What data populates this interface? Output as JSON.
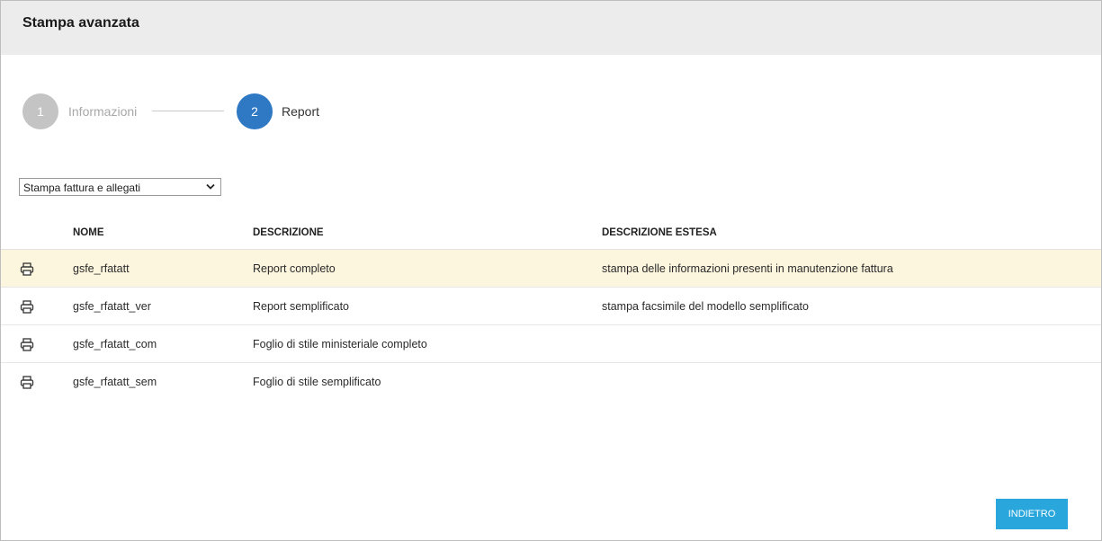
{
  "dialog": {
    "title": "Stampa avanzata"
  },
  "stepper": {
    "steps": [
      {
        "number": "1",
        "label": "Informazioni"
      },
      {
        "number": "2",
        "label": "Report"
      }
    ]
  },
  "report_select": {
    "selected": "Stampa fattura e allegati"
  },
  "table": {
    "headers": {
      "name": "NOME",
      "description": "DESCRIZIONE",
      "extended": "DESCRIZIONE ESTESA"
    },
    "rows": [
      {
        "name": "gsfe_rfatatt",
        "description": "Report completo",
        "extended": "stampa delle informazioni presenti in manutenzione fattura",
        "icon": "printer-icon"
      },
      {
        "name": "gsfe_rfatatt_ver",
        "description": "Report semplificato",
        "extended": "stampa facsimile del modello semplificato",
        "icon": "printer-icon"
      },
      {
        "name": "gsfe_rfatatt_com",
        "description": "Foglio di stile ministeriale completo",
        "extended": "",
        "icon": "printer-icon"
      },
      {
        "name": "gsfe_rfatatt_sem",
        "description": "Foglio di stile semplificato",
        "extended": "",
        "icon": "printer-icon"
      }
    ]
  },
  "footer": {
    "back_label": "INDIETRO"
  },
  "colors": {
    "accent": "#2f78c4",
    "button": "#29a6dc",
    "highlight_row": "#fdf6de",
    "header_bg": "#ececec"
  }
}
